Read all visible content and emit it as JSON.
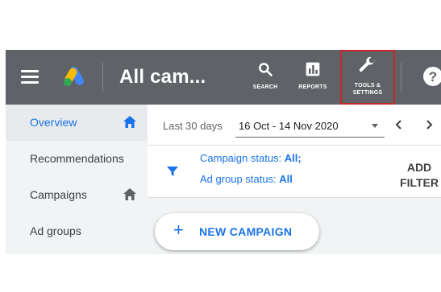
{
  "header": {
    "title": "All cam...",
    "tools": [
      {
        "label": "SEARCH",
        "icon": "search-icon"
      },
      {
        "label": "REPORTS",
        "icon": "reports-icon"
      },
      {
        "label_line1": "TOOLS &",
        "label_line2": "SETTINGS",
        "icon": "wrench-icon"
      }
    ],
    "help_icon": "help-icon",
    "colors": {
      "bar": "#5f6368",
      "highlight_border": "#c62828"
    }
  },
  "sidebar": {
    "items": [
      {
        "label": "Overview",
        "active": true,
        "home_icon": true
      },
      {
        "label": "Recommendations",
        "active": false,
        "home_icon": false
      },
      {
        "label": "Campaigns",
        "active": false,
        "home_icon": true
      },
      {
        "label": "Ad groups",
        "active": false,
        "home_icon": false
      }
    ]
  },
  "datebar": {
    "range_label": "Last 30 days",
    "range_value": "16 Oct - 14 Nov 2020"
  },
  "filters": {
    "campaign_status_label": "Campaign status:",
    "campaign_status_value": "All;",
    "ad_group_status_label": "Ad group status:",
    "ad_group_status_value": "All",
    "add_filter_line1": "ADD",
    "add_filter_line2": "FILTER"
  },
  "main": {
    "new_campaign_label": "NEW CAMPAIGN",
    "accent_color": "#1a73e8"
  }
}
